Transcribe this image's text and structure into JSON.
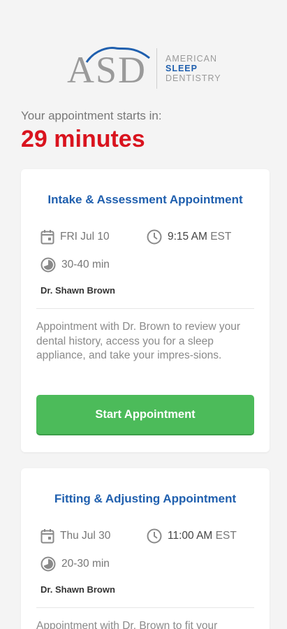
{
  "logo": {
    "mark": "ASD",
    "line1": "AMERICAN",
    "line2": "SLEEP",
    "line3": "DENTISTRY"
  },
  "countdown": {
    "label": "Your appointment starts in:",
    "value": "29 minutes"
  },
  "appointments": [
    {
      "title": "Intake & Assessment Appointment",
      "date": "FRI Jul 10",
      "time": "9:15 AM",
      "tz": "EST",
      "duration": "30-40 min",
      "doctor": "Dr. Shawn Brown",
      "description": "Appointment with Dr. Brown to review your dental history, access you for a sleep appliance, and take your impres-sions.",
      "button": "Start Appointment"
    },
    {
      "title": "Fitting & Adjusting Appointment",
      "date": "Thu Jul 30",
      "time": "11:00 AM",
      "tz": "EST",
      "duration": "20-30 min",
      "doctor": "Dr. Shawn Brown",
      "description": "Appointment with Dr. Brown to fit your"
    }
  ],
  "colors": {
    "brand_blue": "#1f5fae",
    "countdown_red": "#d9131e",
    "button_green": "#4cbb5a"
  },
  "icons": [
    "calendar-icon",
    "clock-icon",
    "duration-icon"
  ]
}
